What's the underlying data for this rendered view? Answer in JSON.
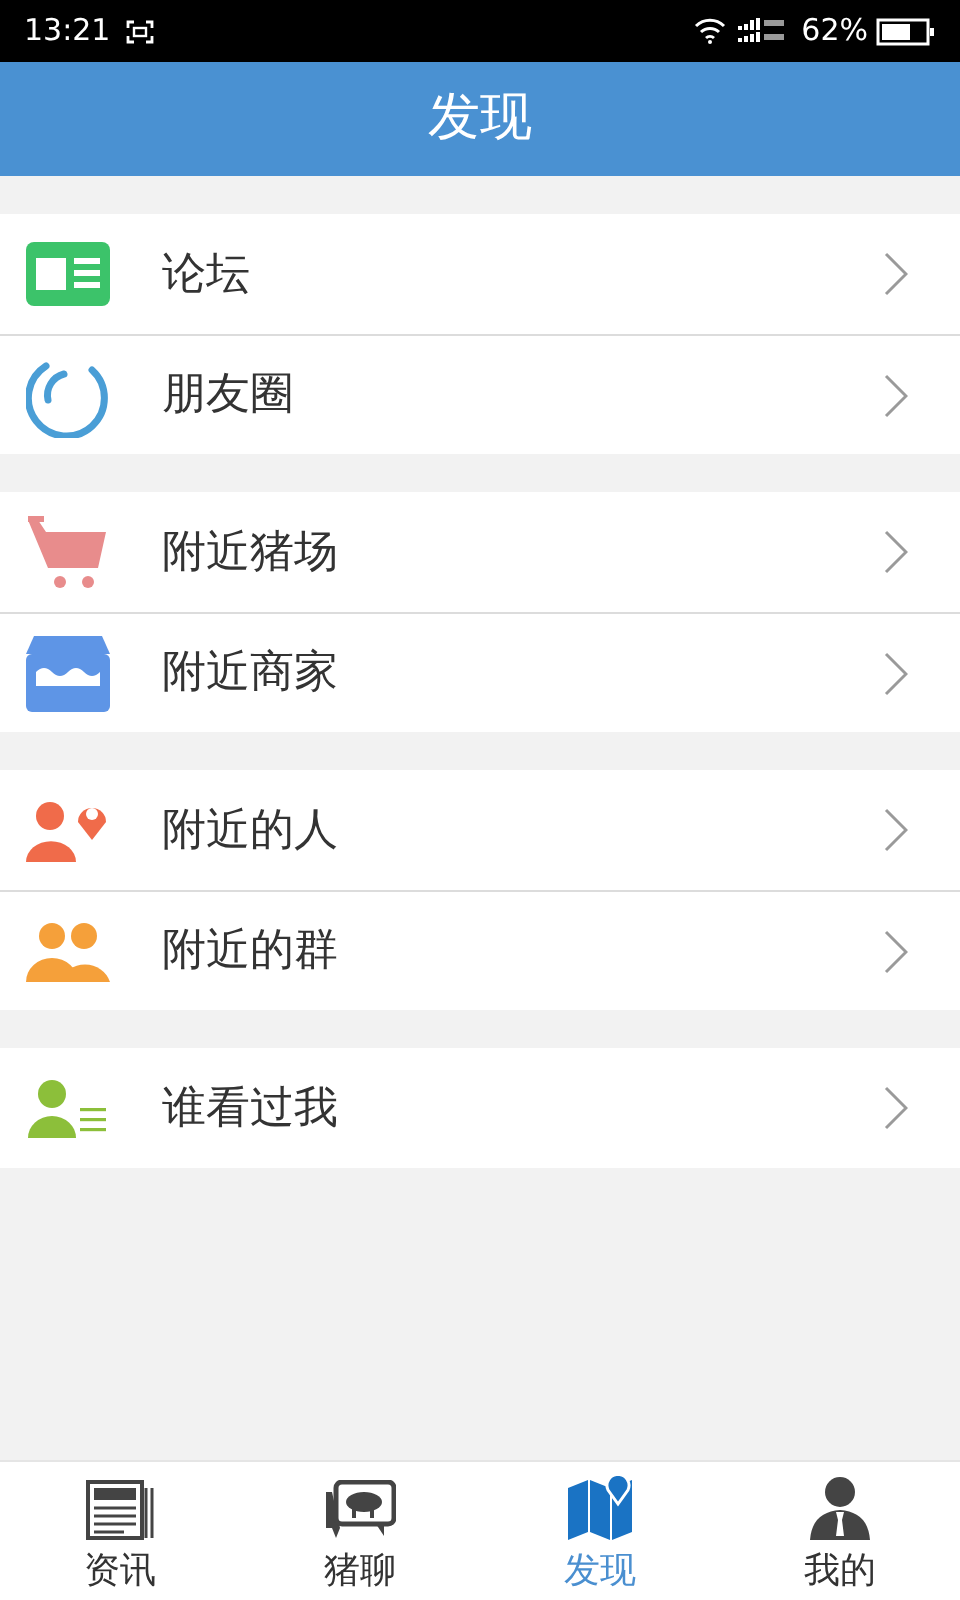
{
  "status_bar": {
    "time": "13:21",
    "battery": "62%"
  },
  "header": {
    "title": "发现"
  },
  "groups": [
    {
      "items": [
        {
          "label": "论坛",
          "kind": "forum"
        },
        {
          "label": "朋友圈",
          "kind": "moments"
        }
      ]
    },
    {
      "items": [
        {
          "label": "附近猪场",
          "kind": "cart"
        },
        {
          "label": "附近商家",
          "kind": "shop"
        }
      ]
    },
    {
      "items": [
        {
          "label": "附近的人",
          "kind": "people"
        },
        {
          "label": "附近的群",
          "kind": "group"
        }
      ]
    },
    {
      "items": [
        {
          "label": "谁看过我",
          "kind": "visitors"
        }
      ]
    }
  ],
  "tabs": [
    {
      "label": "资讯",
      "kind": "news",
      "selected": false
    },
    {
      "label": "猪聊",
      "kind": "chat",
      "selected": false
    },
    {
      "label": "发现",
      "kind": "map",
      "selected": true
    },
    {
      "label": "我的",
      "kind": "me",
      "selected": false
    }
  ]
}
